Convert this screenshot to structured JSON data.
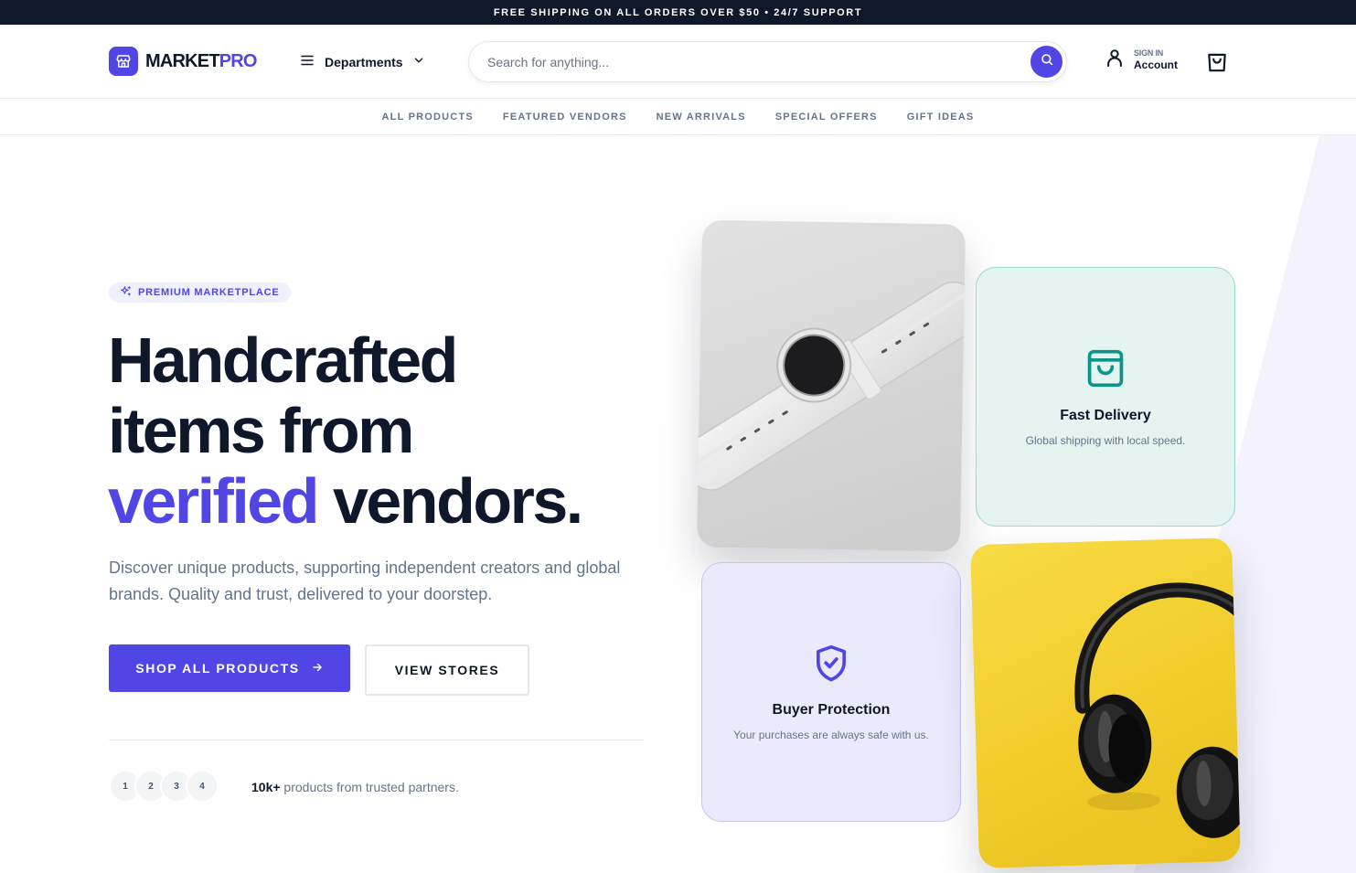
{
  "announcement": "FREE SHIPPING ON ALL ORDERS OVER $50 • 24/7 SUPPORT",
  "header": {
    "logo_main": "MARKET",
    "logo_accent": "PRO",
    "departments_label": "Departments",
    "search_placeholder": "Search for anything...",
    "signin_label": "SIGN IN",
    "account_label": "Account"
  },
  "category_nav": [
    "ALL PRODUCTS",
    "FEATURED VENDORS",
    "NEW ARRIVALS",
    "SPECIAL OFFERS",
    "GIFT IDEAS"
  ],
  "hero": {
    "badge": "PREMIUM MARKETPLACE",
    "headline_line1": "Handcrafted",
    "headline_line2": "items from",
    "headline_accent": "verified",
    "headline_rest": " vendors.",
    "subtext": "Discover unique products, supporting independent creators and global brands. Quality and trust, delivered to your doorstep.",
    "primary_cta": "SHOP ALL PRODUCTS",
    "secondary_cta": "VIEW STORES",
    "avatars": [
      "1",
      "2",
      "3",
      "4"
    ],
    "stat_bold": "10k+",
    "stat_text": " products from trusted partners."
  },
  "features": {
    "delivery_title": "Fast Delivery",
    "delivery_desc": "Global shipping with local speed.",
    "protection_title": "Buyer Protection",
    "protection_desc": "Your purchases are always safe with us."
  },
  "colors": {
    "brand": "#4f46e5",
    "dark": "#0f172a",
    "muted": "#64748b",
    "teal": "#0d9488",
    "delivery_bg": "#e3f4f1",
    "protection_bg": "#ebeafc",
    "phones_bg": "#f1cc2a"
  },
  "icons": [
    "storefront-icon",
    "menu-icon",
    "chevron-down-icon",
    "search-icon",
    "user-icon",
    "shopping-bag-icon",
    "sparkle-icon",
    "arrow-right-icon",
    "delivery-bag-icon",
    "shield-check-icon"
  ]
}
